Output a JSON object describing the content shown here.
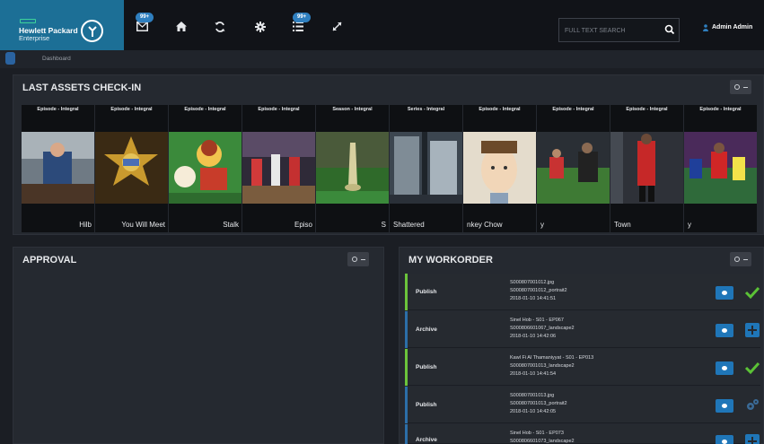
{
  "brand": {
    "name": "Hewlett Packard",
    "sub": "Enterprise"
  },
  "nav": {
    "mail_badge": "99+",
    "tasks_badge": "99+"
  },
  "search": {
    "placeholder": "FULL TEXT SEARCH"
  },
  "user": {
    "name": "Admin Admin"
  },
  "breadcrumb": {
    "label": "Dashboard"
  },
  "assets_panel": {
    "title": "LAST ASSETS CHECK-IN",
    "items": [
      {
        "category": "Episode - Integral",
        "title": "Hilb"
      },
      {
        "category": "Episode - Integral",
        "title": "You Will Meet"
      },
      {
        "category": "Episode - Integral",
        "title": "Stalk"
      },
      {
        "category": "Episode - Integral",
        "title": "Episo"
      },
      {
        "category": "Season - Integral",
        "title": "S"
      },
      {
        "category": "Series - Integral",
        "title": "Shattered"
      },
      {
        "category": "Episode - Integral",
        "title": "nkey Chow"
      },
      {
        "category": "Episode - Integral",
        "title": "y"
      },
      {
        "category": "Episode - Integral",
        "title": "Town"
      },
      {
        "category": "Episode - Integral",
        "title": "y"
      }
    ]
  },
  "approval_panel": {
    "title": "APPROVAL"
  },
  "workorder_panel": {
    "title": "MY WORKORDER",
    "rows": [
      {
        "type": "Publish",
        "lines": [
          "S000807001012.jpg",
          "S000807001012_portrait2",
          "2018-01-10 14:41:51"
        ],
        "status": "done"
      },
      {
        "type": "Archive",
        "lines": [
          "Sinel Hob - S01 - EP067",
          "S000806601067_landscape2",
          "2018-01-10 14:42:06"
        ],
        "status": "pending"
      },
      {
        "type": "Publish",
        "lines": [
          "Kawl Fi Al Thamaniyyat - S01 - EP013",
          "S000807001013_landscape2",
          "2018-01-10 14:41:54"
        ],
        "status": "done"
      },
      {
        "type": "Publish",
        "lines": [
          "S000807001013.jpg",
          "S000807001013_portrait2",
          "2018-01-10 14:42:05"
        ],
        "status": "processing"
      },
      {
        "type": "Archive",
        "lines": [
          "Sinel Hob - S01 - EP073",
          "S000806601073_landscape2"
        ],
        "status": "pending"
      }
    ]
  },
  "colors": {
    "brand": "#1c6f96",
    "accent_blue": "#1f76b8",
    "success_green": "#5bc236",
    "row_accent_green": "#6bc43b",
    "row_accent_blue": "#2c6ea8"
  },
  "icons": [
    "mail-icon",
    "home-icon",
    "refresh-icon",
    "gear-icon",
    "list-icon",
    "expand-icon",
    "search-icon",
    "user-icon",
    "eye-icon",
    "check-icon",
    "plus-icon",
    "cog-icon"
  ]
}
